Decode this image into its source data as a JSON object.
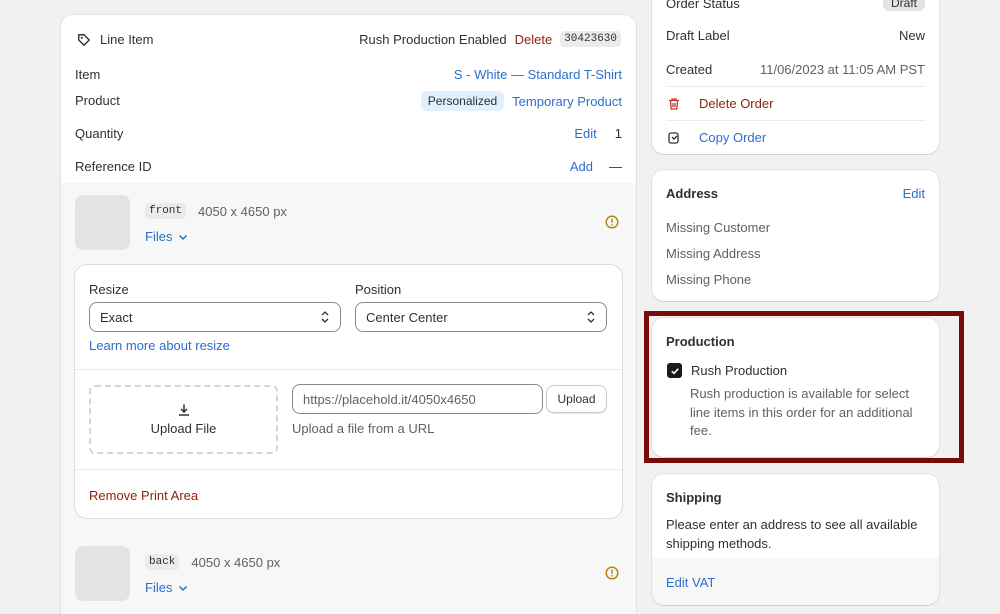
{
  "line_item": {
    "title": "Line Item",
    "rush_label": "Rush Production Enabled",
    "delete_label": "Delete",
    "id": "30423630",
    "item_label": "Item",
    "item_value": "S - White — Standard T-Shirt",
    "product_label": "Product",
    "product_badge": "Personalized",
    "product_value": "Temporary Product",
    "quantity_label": "Quantity",
    "quantity_edit": "Edit",
    "quantity_value": "1",
    "reference_label": "Reference ID",
    "reference_add": "Add",
    "reference_value": "—"
  },
  "print_areas": [
    {
      "tag": "front",
      "size": "4050 x 4650 px",
      "files_label": "Files"
    },
    {
      "tag": "back",
      "size": "4050 x 4650 px",
      "files_label": "Files"
    }
  ],
  "print_settings": {
    "resize_label": "Resize",
    "resize_value": "Exact",
    "position_label": "Position",
    "position_value": "Center Center",
    "learn_more": "Learn more about resize",
    "upload_file": "Upload File",
    "url_value": "https://placehold.it/4050x4650",
    "upload_button": "Upload",
    "upload_hint": "Upload a file from a URL",
    "remove_label": "Remove Print Area"
  },
  "order": {
    "status_label": "Order Status",
    "status_value": "Draft",
    "draft_label": "Draft Label",
    "draft_value": "New",
    "created_label": "Created",
    "created_value": "11/06/2023 at 11:05 AM PST",
    "delete_order": "Delete Order",
    "copy_order": "Copy Order"
  },
  "address": {
    "title": "Address",
    "edit": "Edit",
    "missing_customer": "Missing Customer",
    "missing_address": "Missing Address",
    "missing_phone": "Missing Phone"
  },
  "production": {
    "title": "Production",
    "checkbox_label": "Rush Production",
    "checked": true,
    "description": "Rush production is available for select line items in this order for an additional fee."
  },
  "shipping": {
    "title": "Shipping",
    "message": "Please enter an address to see all available shipping methods.",
    "edit_vat": "Edit VAT"
  },
  "colors": {
    "link": "#2c6ecb",
    "danger": "#8e1f0b",
    "highlight_border": "#7a0a0a",
    "warning_icon": "#b28500"
  }
}
